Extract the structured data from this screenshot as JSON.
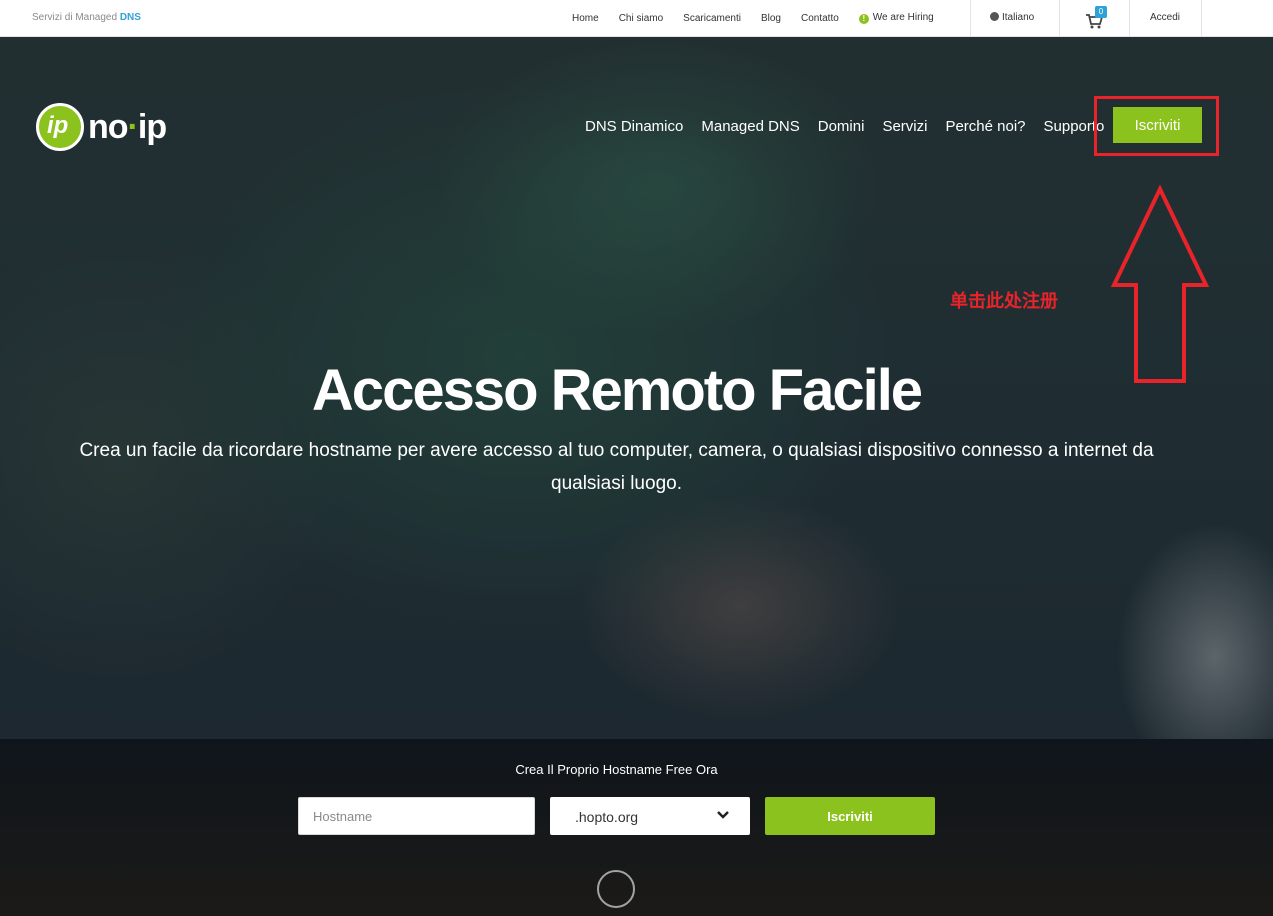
{
  "topbar": {
    "tagline_prefix": "Servizi di Managed",
    "tagline_highlight": "DNS",
    "links": [
      "Home",
      "Chi siamo",
      "Scaricamenti",
      "Blog",
      "Contatto"
    ],
    "hiring": "We are Hiring",
    "language": "Italiano",
    "cart_count": "0",
    "login": "Accedi"
  },
  "logo": {
    "mark": "ip",
    "name_a": "no",
    "name_dot": "·",
    "name_b": "ip"
  },
  "mainnav": {
    "items": [
      "DNS Dinamico",
      "Managed DNS",
      "Domini",
      "Servizi",
      "Perché noi?",
      "Supporto"
    ],
    "signup_label": "Iscriviti"
  },
  "annotation": {
    "text": "单击此处注册",
    "color": "#e8232a"
  },
  "hero": {
    "title": "Accesso Remoto Facile",
    "subtitle": "Crea un facile da ricordare hostname per avere accesso al tuo computer, camera, o qualsiasi dispositivo connesso a internet da qualsiasi luogo."
  },
  "signup_strip": {
    "title": "Crea Il Proprio Hostname Free Ora",
    "hostname_placeholder": "Hostname",
    "domain_value": ".hopto.org",
    "button_label": "Iscriviti"
  },
  "colors": {
    "accent_green": "#8cc21d",
    "accent_blue": "#2fa3d6"
  },
  "icons": [
    "info-icon",
    "globe-icon",
    "cart-icon",
    "chevron-down-icon",
    "scroll-down-icon"
  ]
}
